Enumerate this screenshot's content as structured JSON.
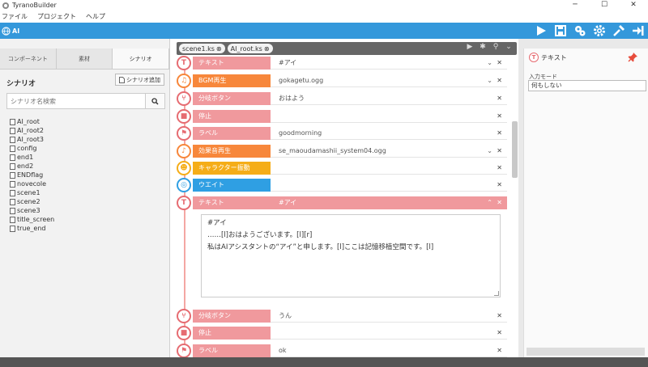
{
  "window": {
    "title": "TyranoBuilder",
    "minimize": "─",
    "maximize": "☐",
    "close": "✕"
  },
  "menu": [
    "ファイル",
    "プロジェクト",
    "ヘルプ"
  ],
  "header": {
    "project": "AI"
  },
  "left_panel": {
    "tabs": [
      "コンポーネント",
      "素材",
      "シナリオ"
    ],
    "active_tab": 2,
    "section_label": "シナリオ",
    "add_button": "シナリオ追加",
    "search_placeholder": "シナリオ名検索",
    "files": [
      "AI_root",
      "AI_root2",
      "AI_root3",
      "config",
      "end1",
      "end2",
      "ENDflag",
      "novecole",
      "scene1",
      "scene2",
      "scene3",
      "title_screen",
      "true_end"
    ]
  },
  "file_tabs": [
    "scene1.ks",
    "AI_root.ks"
  ],
  "rows": [
    {
      "label": "テキスト",
      "value": "#アイ",
      "color": "pink",
      "chevron": true
    },
    {
      "label": "BGM再生",
      "value": "gokagetu.ogg",
      "color": "orange",
      "chevron": true
    },
    {
      "label": "分岐ボタン",
      "value": "おはよう",
      "color": "pink",
      "chevron": false
    },
    {
      "label": "停止",
      "value": "",
      "color": "pink",
      "chevron": false
    },
    {
      "label": "ラベル",
      "value": "goodmorning",
      "color": "pink",
      "chevron": false
    },
    {
      "label": "効果音再生",
      "value": "se_maoudamashii_system04.ogg",
      "color": "orange",
      "chevron": true
    },
    {
      "label": "キャラクター振動",
      "value": "",
      "color": "yellow",
      "chevron": false
    },
    {
      "label": "ウエイト",
      "value": "",
      "color": "blue",
      "chevron": false
    },
    {
      "label": "テキスト",
      "value": "#アイ",
      "color": "pink",
      "chevron": false,
      "expanded": true
    },
    {
      "label": "分岐ボタン",
      "value": "うん",
      "color": "pink",
      "chevron": false
    },
    {
      "label": "停止",
      "value": "",
      "color": "pink",
      "chevron": false
    },
    {
      "label": "ラベル",
      "value": "ok",
      "color": "pink",
      "chevron": false
    }
  ],
  "editor_lines": [
    "#アイ",
    "……[l]おはようございます。[l][r]",
    "私はAIアシスタントの“アイ”と申します。[l]ここは記憶移植空間です。[l]"
  ],
  "right_panel": {
    "title": "テキスト",
    "field_label": "入力モード",
    "field_value": "何もしない"
  }
}
